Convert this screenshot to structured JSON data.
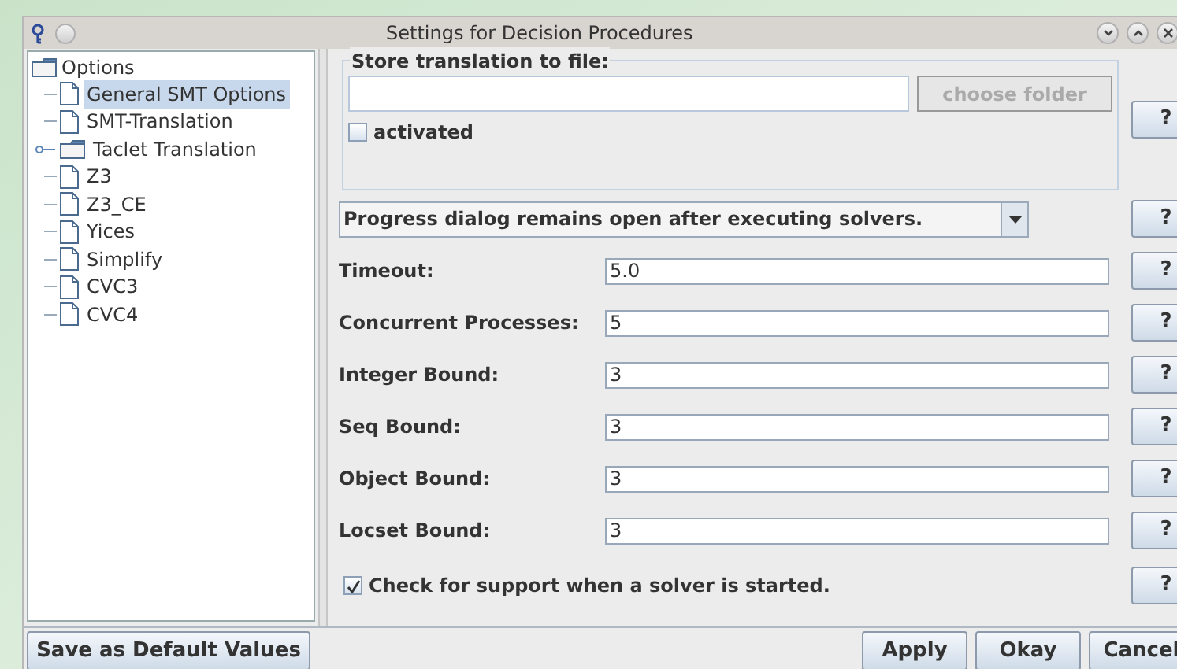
{
  "window": {
    "title": "Settings for Decision Procedures"
  },
  "tree": {
    "label": "Options",
    "children": [
      {
        "label": "General SMT Options",
        "kind": "file",
        "selected": true
      },
      {
        "label": "SMT-Translation",
        "kind": "file",
        "selected": false
      },
      {
        "label": "Taclet Translation",
        "kind": "folder",
        "selected": false,
        "expanded": false
      },
      {
        "label": "Z3",
        "kind": "file",
        "selected": false
      },
      {
        "label": "Z3_CE",
        "kind": "file",
        "selected": false
      },
      {
        "label": "Yices",
        "kind": "file",
        "selected": false
      },
      {
        "label": "Simplify",
        "kind": "file",
        "selected": false
      },
      {
        "label": "CVC3",
        "kind": "file",
        "selected": false
      },
      {
        "label": "CVC4",
        "kind": "file",
        "selected": false
      }
    ]
  },
  "store": {
    "legend": "Store translation to file:",
    "button": "choose folder",
    "button_disabled": true,
    "checkbox": {
      "label": "activated",
      "checked": false
    },
    "help": "?"
  },
  "progress": {
    "value": "Progress dialog remains open after executing solvers.",
    "help": "?"
  },
  "fields": [
    {
      "label": "Timeout:",
      "value": "5.0",
      "help": "?"
    },
    {
      "label": "Concurrent Processes:",
      "value": "5",
      "help": "?"
    },
    {
      "label": "Integer Bound:",
      "value": "3",
      "help": "?"
    },
    {
      "label": "Seq Bound:",
      "value": "3",
      "help": "?"
    },
    {
      "label": "Object Bound:",
      "value": "3",
      "help": "?"
    },
    {
      "label": "Locset Bound:",
      "value": "3",
      "help": "?"
    }
  ],
  "support": {
    "label": "Check for support when a solver is started.",
    "checked": true,
    "help": "?"
  },
  "buttons": {
    "left": "Save as Default Values",
    "right": [
      "Apply",
      "Okay",
      "Cancel"
    ]
  }
}
